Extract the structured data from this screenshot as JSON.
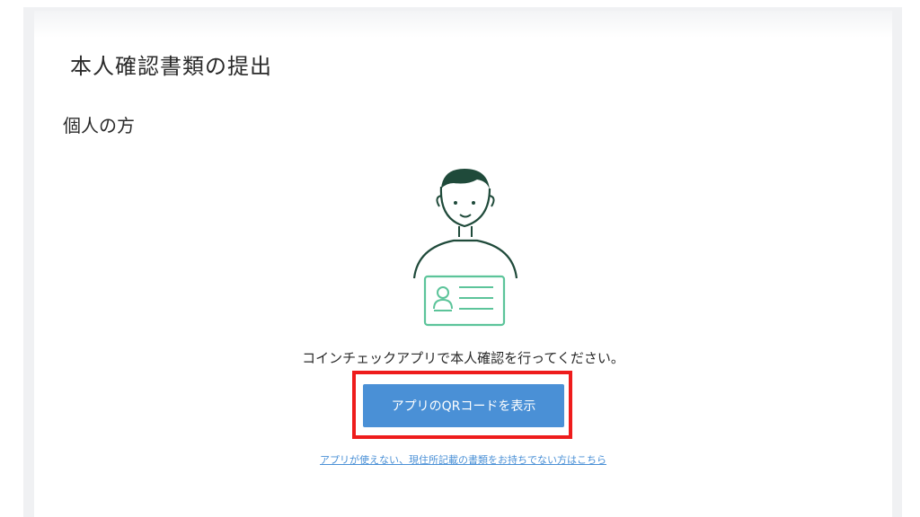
{
  "page": {
    "title": "本人確認書類の提出",
    "section_title": "個人の方"
  },
  "illustration": {
    "icon": "person-with-id-card-icon",
    "colors": {
      "person": "#1f4a3a",
      "card": "#5cc49a"
    }
  },
  "instruction": "コインチェックアプリで本人確認を行ってください。",
  "qr_button": {
    "label": "アプリのQRコードを表示",
    "color": "#4a90d6"
  },
  "highlight_color": "#ee1c1c",
  "alt_link": "アプリが使えない、現住所記載の書類をお持ちでない方はこちら"
}
